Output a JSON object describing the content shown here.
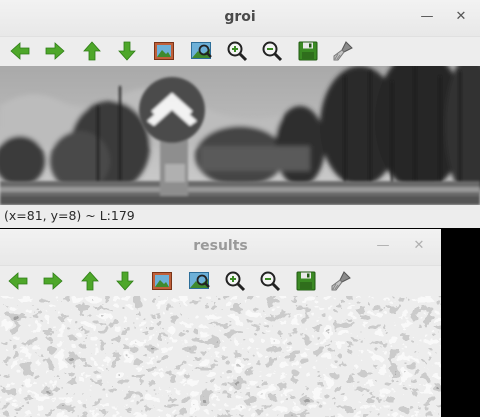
{
  "windows": {
    "groi": {
      "title": "groi",
      "status_text": "(x=81, y=8) ~ L:179",
      "controls": [
        "minimize-icon",
        "close-icon"
      ]
    },
    "results": {
      "title": "results",
      "controls": [
        "minimize-icon",
        "close-icon"
      ]
    }
  },
  "toolbar": {
    "buttons": [
      {
        "icon": "arrow-left-icon"
      },
      {
        "icon": "arrow-right-icon"
      },
      {
        "icon": "arrow-up-icon"
      },
      {
        "icon": "arrow-down-icon"
      },
      {
        "icon": "image-icon"
      },
      {
        "icon": "zoom-fit-icon"
      },
      {
        "icon": "zoom-in-icon"
      },
      {
        "icon": "zoom-out-icon"
      },
      {
        "icon": "save-icon"
      },
      {
        "icon": "brush-icon"
      }
    ]
  },
  "colors": {
    "window_bg": "#ededed",
    "arrow_green": "#4ea72a",
    "screen_bg": "#000000"
  }
}
